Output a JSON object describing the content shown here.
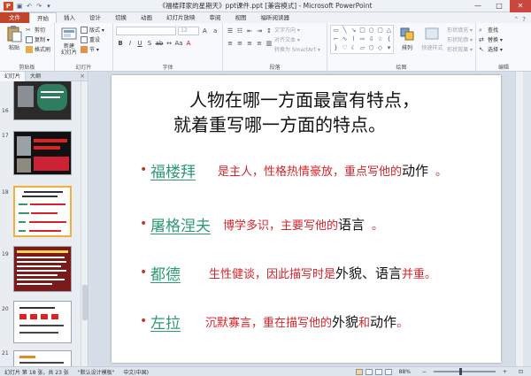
{
  "window": {
    "title": "《福楼拜家的星期天》ppt课件.ppt [兼容模式] - Microsoft PowerPoint",
    "app_letter": "P",
    "controls": [
      "—",
      "□",
      "✕"
    ]
  },
  "ribbon_tabs": [
    "文件",
    "开始",
    "插入",
    "设计",
    "切换",
    "动画",
    "幻灯片放映",
    "审阅",
    "视图",
    "福昕阅读器"
  ],
  "ribbon": {
    "clipboard": {
      "label": "剪贴板",
      "paste": "粘贴",
      "cut": "剪切",
      "copy": "复制 ▾",
      "format_painter": "格式刷"
    },
    "slides": {
      "label": "幻灯片",
      "new_slide": "新建\n幻灯片",
      "layout": "版式 ▾",
      "reset": "重设",
      "section": "节 ▾"
    },
    "font": {
      "label": "字体",
      "font_size": "12"
    },
    "paragraph": {
      "label": "段落",
      "text_direction": "文字方向 ▾",
      "align_text": "对齐文本 ▾",
      "smartart": "转换为 SmartArt ▾"
    },
    "drawing": {
      "label": "绘图",
      "arrange": "排列",
      "quick_styles": "快速样式",
      "shape_fill": "形状填充 ▾",
      "shape_outline": "形状轮廓 ▾",
      "shape_effects": "形状效果 ▾"
    },
    "editing": {
      "label": "编辑",
      "find": "查找",
      "replace": "替换 ▾",
      "select": "选择 ▾"
    }
  },
  "left_pane": {
    "tabs": [
      "幻灯片",
      "大纲"
    ],
    "close": "×",
    "thumbnails": [
      {
        "num": "16"
      },
      {
        "num": "17"
      },
      {
        "num": "18",
        "active": true
      },
      {
        "num": "19"
      },
      {
        "num": "20"
      },
      {
        "num": "21"
      }
    ]
  },
  "slide": {
    "title_line1": "人物在哪一方面最富有特点，",
    "title_line2": "就着重写哪一方面的特点。",
    "bullets": [
      {
        "name": "福楼拜",
        "red": "是主人，性格热情豪放，重点写他的",
        "black": "动作",
        "tail": "。"
      },
      {
        "name": "屠格涅夫",
        "red": "博学多识，主要写他的",
        "black": "语言",
        "tail": "。"
      },
      {
        "name": "都德",
        "red": "生性健谈，因此描写时是",
        "black": "外貌、语言",
        "tail": "并重。"
      },
      {
        "name": "左拉",
        "red": "沉默寡言，重在描写他的",
        "black": "外貌",
        "mid": "和",
        "black2": "动作",
        "tail": "。"
      }
    ]
  },
  "status": {
    "slide_info": "幻灯片 第 18 张，共 23 张",
    "theme": "\"默认设计模板\"",
    "language": "中文(中国)",
    "zoom": "88%",
    "zoom_fraction": 0.44
  },
  "colors": {
    "file_tab": "#c0452a",
    "bullet_name": "#2f9a70",
    "bullet_red": "#d8232a"
  }
}
